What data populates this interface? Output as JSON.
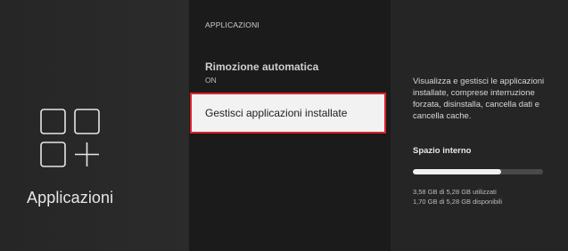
{
  "sidebar": {
    "title": "Applicazioni",
    "icon": "apps-grid-add-icon"
  },
  "menu": {
    "section_header": "APPLICAZIONI",
    "items": [
      {
        "label": "Rimozione automatica",
        "value": "ON",
        "selected": false
      },
      {
        "label": "Gestisci applicazioni installate",
        "selected": true
      }
    ]
  },
  "details": {
    "description": "Visualizza e gestisci le applicazioni installate, comprese interruzione forzata, disinstalla, cancella dati e cancella cache.",
    "storage": {
      "title": "Spazio interno",
      "used_fraction": 0.678,
      "used_text": "3,58 GB di 5,28 GB utilizzati",
      "free_text": "1,70 GB di 5,28 GB disponibili"
    }
  },
  "colors": {
    "selection_border": "#d9232e",
    "selected_bg": "#f2f2f2",
    "bar_fill": "#f0f0f0",
    "bar_track": "#4a4a4a"
  }
}
